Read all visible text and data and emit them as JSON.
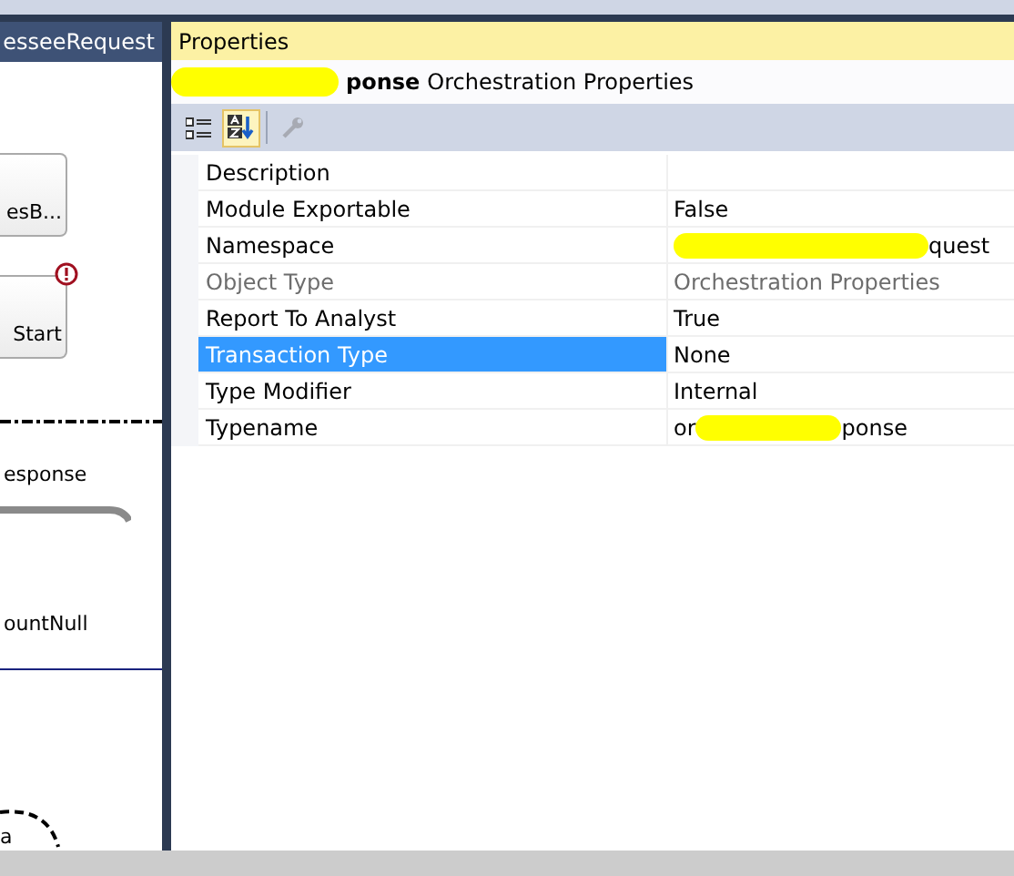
{
  "designer": {
    "title": "esseeRequest",
    "shapes": [
      {
        "kind": "box",
        "label": "esB..."
      },
      {
        "kind": "box",
        "label": "Start",
        "error": true
      },
      {
        "kind": "separator"
      },
      {
        "kind": "text",
        "label": "esponse"
      },
      {
        "kind": "text",
        "label": "ountNull"
      },
      {
        "kind": "arc",
        "label": "a"
      }
    ]
  },
  "properties": {
    "title": "Properties",
    "subject": {
      "name": "ponse",
      "type": "Orchestration Properties",
      "redacted": true
    },
    "toolbar": [
      {
        "kind": "categorized",
        "selected": false,
        "disabled": false
      },
      {
        "kind": "alphabetical",
        "selected": true,
        "disabled": false
      },
      {
        "kind": "property-pages",
        "selected": false,
        "disabled": true
      }
    ],
    "rows": [
      {
        "name": "Description",
        "selected": false,
        "readonly": false
      },
      {
        "name": "Module Exportable",
        "value": "False",
        "selected": false,
        "readonly": false
      },
      {
        "name": "Namespace",
        "value_segments": [
          {
            "kind": "redacted"
          },
          {
            "kind": "text",
            "text": "quest"
          }
        ],
        "selected": false,
        "readonly": false
      },
      {
        "name": "Object Type",
        "value": "Orchestration Properties",
        "selected": false,
        "readonly": true
      },
      {
        "name": "Report To Analyst",
        "value": "True",
        "selected": false,
        "readonly": false
      },
      {
        "name": "Transaction Type",
        "value": "None",
        "selected": true,
        "readonly": false
      },
      {
        "name": "Type Modifier",
        "value": "Internal",
        "selected": false,
        "readonly": false
      },
      {
        "name": "Typename",
        "value_segments": [
          {
            "kind": "text",
            "text": "or"
          },
          {
            "kind": "redacted"
          },
          {
            "kind": "text",
            "text": "ponse"
          }
        ],
        "selected": false,
        "readonly": false
      }
    ]
  }
}
